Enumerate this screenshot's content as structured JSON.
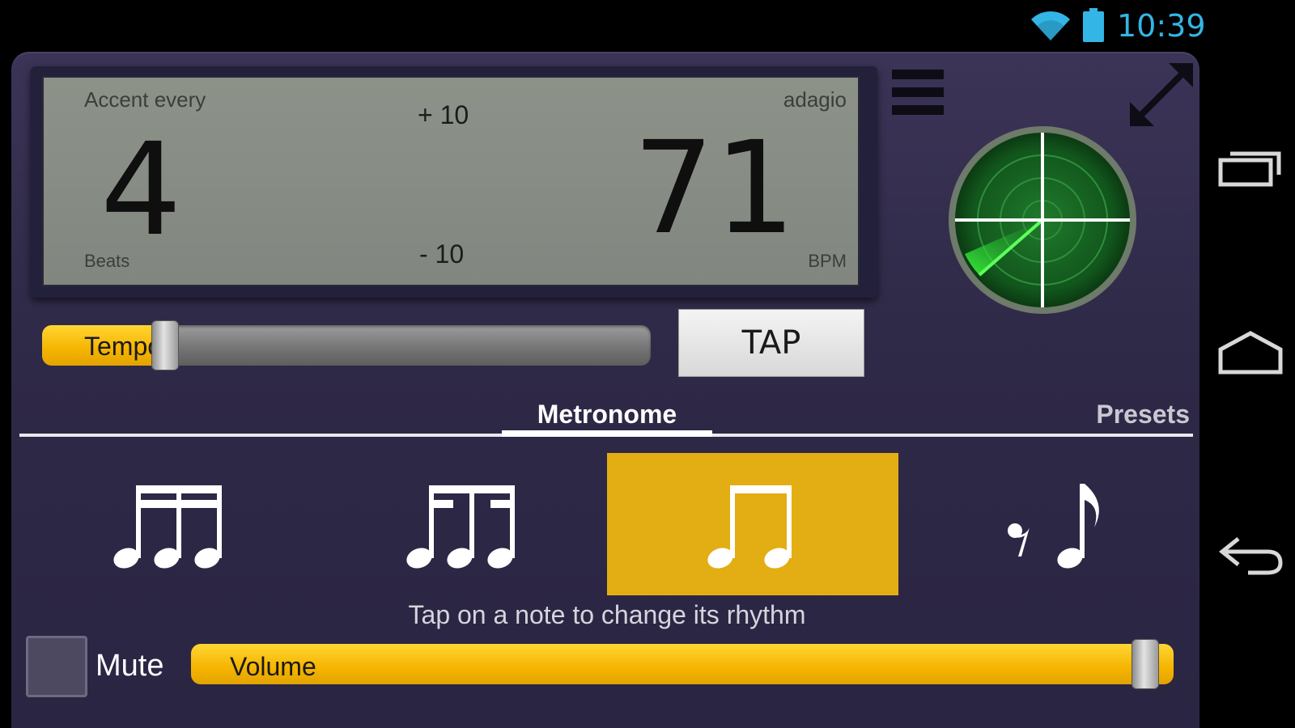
{
  "status_bar": {
    "time": "10:39",
    "icons": [
      "wifi-icon",
      "battery-icon"
    ],
    "time_color": "#33b5e5"
  },
  "display": {
    "accent_label": "Accent every",
    "beats_value": "4",
    "beats_label": "Beats",
    "increment_label": "+ 10",
    "decrement_label": "- 10",
    "tempo_name": "adagio",
    "bpm_value": "71",
    "bpm_label": "BPM"
  },
  "tempo_slider": {
    "label": "Tempo",
    "level_fraction": 0.18
  },
  "tap_button": {
    "label": "TAP"
  },
  "tabs": [
    {
      "label": "Metronome",
      "selected": true
    },
    {
      "label": "Presets",
      "selected": false
    }
  ],
  "rhythms": [
    {
      "icon": "sixteenth-triplet-notes-icon",
      "selected": false
    },
    {
      "icon": "eighth-triplet-notes-icon",
      "selected": false
    },
    {
      "icon": "eighth-notes-icon",
      "selected": true
    },
    {
      "icon": "rest-eighth-note-icon",
      "selected": false
    }
  ],
  "hint": "Tap on a note to change its rhythm",
  "mute": {
    "label": "Mute",
    "checked": false
  },
  "volume_slider": {
    "label": "Volume",
    "level_fraction": 1.0
  },
  "colors": {
    "accent": "#f5b400",
    "selected_rhythm": "#e3ae13",
    "panel": "#2e2947",
    "lcd": "#8a8f87"
  },
  "nav_bar": [
    "recent-apps-icon",
    "home-icon",
    "back-icon"
  ]
}
